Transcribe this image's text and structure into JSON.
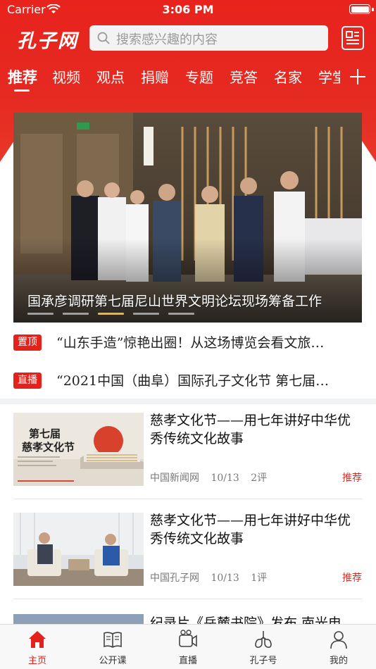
{
  "status_bar": {
    "carrier": "Carrier",
    "time": "3:06 PM"
  },
  "header": {
    "logo_text": "孔子网",
    "search_placeholder": "搜索感兴趣的内容"
  },
  "tabs": [
    {
      "label": "推荐",
      "active": true
    },
    {
      "label": "视频"
    },
    {
      "label": "观点"
    },
    {
      "label": "捐赠"
    },
    {
      "label": "专题"
    },
    {
      "label": "竞答"
    },
    {
      "label": "名家"
    },
    {
      "label": "学堂"
    }
  ],
  "banner": {
    "caption": "国承彦调研第七届尼山世界文明论坛现场筹备工作",
    "slide_count": 5,
    "active_slide": 2
  },
  "headlines": [
    {
      "tag": "置顶",
      "text": "“山东手造”惊艳出圈！从这场博览会看文旅…"
    },
    {
      "tag": "直播",
      "text": "“2021中国（曲阜）国际孔子文化节  第七届…"
    }
  ],
  "articles": [
    {
      "thumb_title": "第七届\n慈孝文化节",
      "title": "慈孝文化节——用七年讲好中华优秀传统文化故事",
      "source": "中国新闻网",
      "date": "10/13",
      "comments": "2评",
      "tag": "推荐"
    },
    {
      "title": "慈孝文化节——用七年讲好中华优秀传统文化故事",
      "source": "中国孔子网",
      "date": "10/13",
      "comments": "1评",
      "tag": "推荐"
    }
  ],
  "peek_article": {
    "title": "纪录片《岳麓书院》发布 南光电"
  },
  "tabbar": [
    {
      "label": "主页",
      "icon": "home-icon",
      "active": true
    },
    {
      "label": "公开课",
      "icon": "book-icon"
    },
    {
      "label": "直播",
      "icon": "live-camera-icon"
    },
    {
      "label": "孔子号",
      "icon": "lungs-icon"
    },
    {
      "label": "我的",
      "icon": "person-icon"
    }
  ],
  "colors": {
    "brand_red": "#e4221b",
    "header_red": "#e8231d",
    "banner_dot_active": "#d8b56d"
  }
}
